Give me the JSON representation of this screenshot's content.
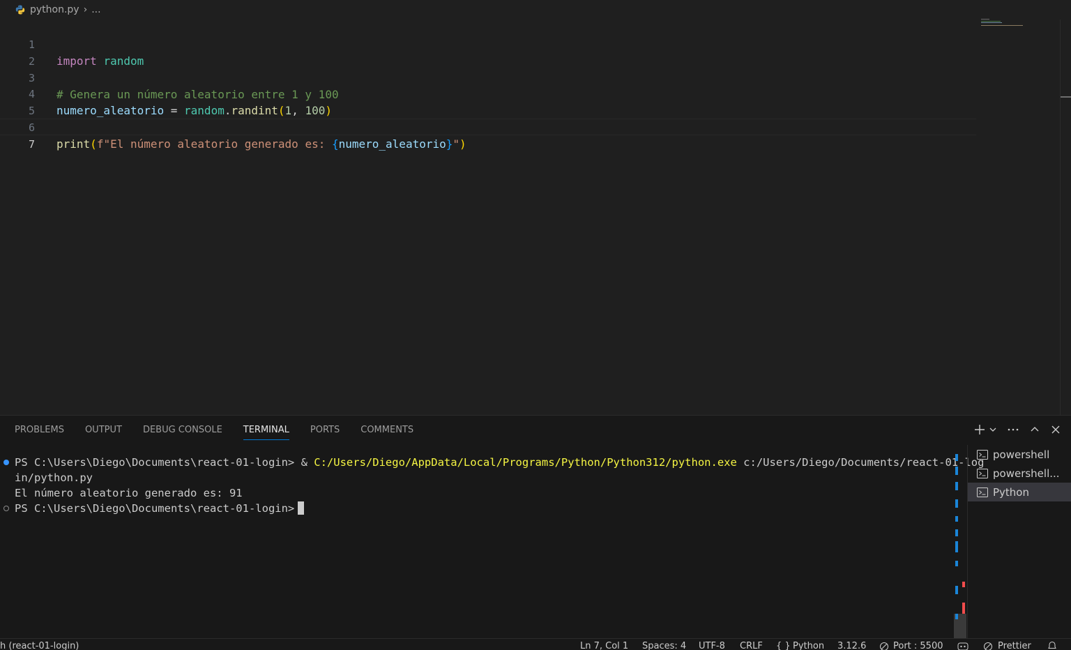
{
  "breadcrumb": {
    "file": "python.py",
    "rest": "..."
  },
  "editor": {
    "line_numbers": [
      "1",
      "2",
      "3",
      "4",
      "5",
      "6",
      "7"
    ],
    "line1": {
      "kw": "import",
      "mod": "random"
    },
    "line3": {
      "comment": "# Genera un número aleatorio entre 1 y 100"
    },
    "line4": {
      "var": "numero_aleatorio",
      "eq": " = ",
      "mod": "random",
      "dot": ".",
      "fn": "randint",
      "open": "(",
      "n1": "1",
      "comma": ", ",
      "n2": "100",
      "close": ")"
    },
    "line6": {
      "fn": "print",
      "open": "(",
      "f": "f",
      "str": "\"El número aleatorio generado es: ",
      "bopen": "{",
      "var": "numero_aleatorio",
      "bclose": "}",
      "strend": "\"",
      "close": ")"
    }
  },
  "panel": {
    "tabs": [
      "PROBLEMS",
      "OUTPUT",
      "DEBUG CONSOLE",
      "TERMINAL",
      "PORTS",
      "COMMENTS"
    ],
    "active_tab": "TERMINAL"
  },
  "terminal": {
    "line1_prompt": "PS C:\\Users\\Diego\\Documents\\react-01-login> & ",
    "line1_exe": "C:/Users/Diego/AppData/Local/Programs/Python/Python312/python.exe",
    "line1_arg": " c:/Users/Diego/Documents/react-01-log",
    "line2": "in/python.py",
    "line3": "El número aleatorio generado es: 91",
    "line4_prompt": "PS C:\\Users\\Diego\\Documents\\react-01-login>"
  },
  "terminal_list": [
    "powershell",
    "powershell...",
    "Python"
  ],
  "statusbar": {
    "branch": "h (react-01-login)",
    "position": "Ln 7, Col 1",
    "spaces": "Spaces: 4",
    "encoding": "UTF-8",
    "eol": "CRLF",
    "language": "Python",
    "version": "3.12.6",
    "port": "Port : 5500",
    "prettier": "Prettier"
  },
  "colors": {
    "accent": "#0078d4",
    "background": "#1f1f1f",
    "panel": "#181818"
  }
}
